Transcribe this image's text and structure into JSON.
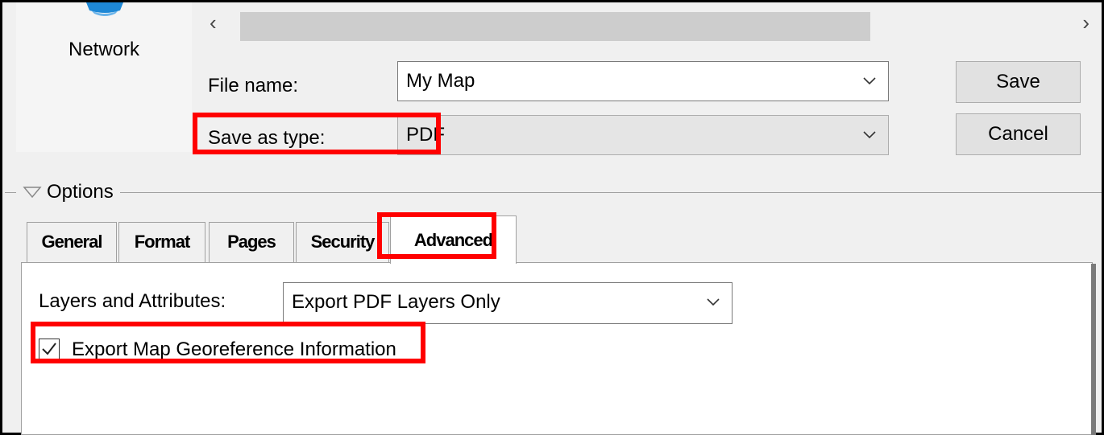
{
  "nav": {
    "network_label": "Network",
    "icon": "network-icon"
  },
  "scrollbar": {
    "left_icon": "chevron-left-icon",
    "right_icon": "chevron-right-icon"
  },
  "form": {
    "file_name_label": "File name:",
    "file_name_value": "My Map",
    "save_as_type_label": "Save as type:",
    "save_as_type_value": "PDF"
  },
  "buttons": {
    "save": "Save",
    "cancel": "Cancel"
  },
  "options": {
    "toggle_icon": "triangle-down-icon",
    "label": "Options"
  },
  "tabs": [
    {
      "label": "General"
    },
    {
      "label": "Format"
    },
    {
      "label": "Pages"
    },
    {
      "label": "Security"
    },
    {
      "label": "Advanced",
      "active": true
    }
  ],
  "advanced": {
    "layers_label": "Layers and Attributes:",
    "layers_value": "Export PDF Layers Only",
    "georef_label": "Export Map Georeference Information",
    "georef_checked": true
  },
  "colors": {
    "highlight": "#ff0000",
    "window_bg": "#f0f0f0"
  }
}
